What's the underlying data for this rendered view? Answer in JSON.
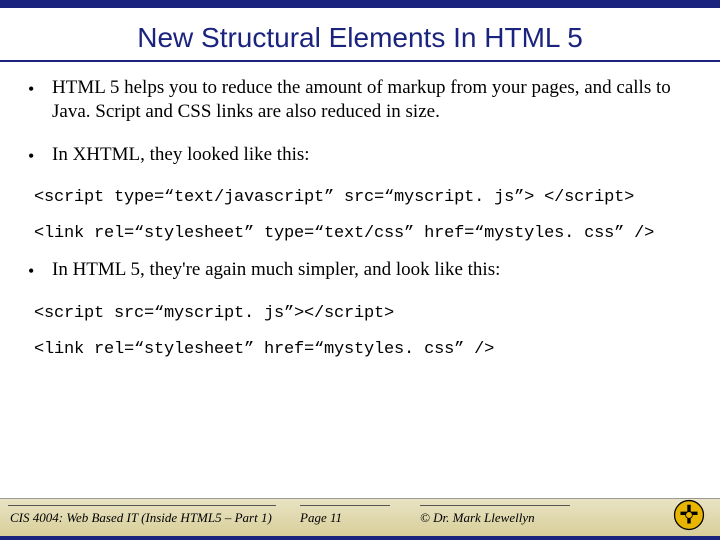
{
  "title": "New Structural Elements In HTML 5",
  "bullets": {
    "b1": "HTML 5 helps you to reduce the amount of markup from your pages, and calls to Java. Script and CSS links are also reduced in size.",
    "b2": "In XHTML, they looked like this:",
    "b3": "In HTML 5, they're again much simpler, and look like this:"
  },
  "code": {
    "c1": "<script type=“text/javascript” src=“myscript. js”> </script>",
    "c2": "<link rel=“stylesheet” type=“text/css” href=“mystyles. css” />",
    "c3": "<script src=“myscript. js”></script>",
    "c4": "<link rel=“stylesheet” href=“mystyles. css” />"
  },
  "footer": {
    "left": "CIS 4004: Web Based IT (Inside HTML5 – Part 1)",
    "center": "Page 11",
    "right": "© Dr. Mark Llewellyn"
  }
}
